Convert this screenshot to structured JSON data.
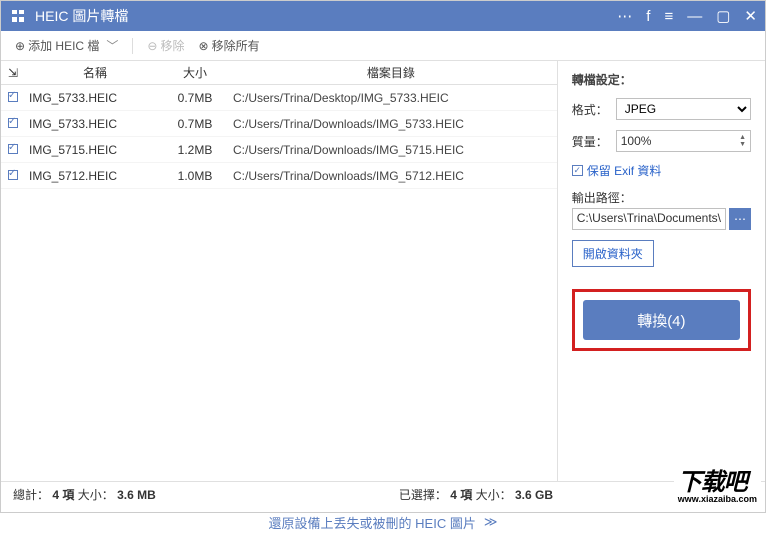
{
  "app": {
    "title": "HEIC 圖片轉檔"
  },
  "toolbar": {
    "add_label": "添加 HEIC 檔",
    "remove_label": "移除",
    "remove_all_label": "移除所有"
  },
  "columns": {
    "name": "名稱",
    "size": "大小",
    "path": "檔案目錄"
  },
  "files": [
    {
      "name": "IMG_5733.HEIC",
      "size": "0.7MB",
      "path": "C:/Users/Trina/Desktop/IMG_5733.HEIC"
    },
    {
      "name": "IMG_5733.HEIC",
      "size": "0.7MB",
      "path": "C:/Users/Trina/Downloads/IMG_5733.HEIC"
    },
    {
      "name": "IMG_5715.HEIC",
      "size": "1.2MB",
      "path": "C:/Users/Trina/Downloads/IMG_5715.HEIC"
    },
    {
      "name": "IMG_5712.HEIC",
      "size": "1.0MB",
      "path": "C:/Users/Trina/Downloads/IMG_5712.HEIC"
    }
  ],
  "settings": {
    "title": "轉檔設定：",
    "format_label": "格式：",
    "format_value": "JPEG",
    "quality_label": "質量：",
    "quality_value": "100%",
    "keep_exif": "保留 Exif 資料",
    "output_label": "輸出路徑：",
    "output_path": "C:\\Users\\Trina\\Documents\\",
    "open_folder": "開啟資料夾"
  },
  "convert": {
    "label": "轉換(4)"
  },
  "status": {
    "total_label": "總計：",
    "total_count": "4 項",
    "total_size_label": "大小：",
    "total_size": "3.6 MB",
    "selected_label": "已選擇：",
    "selected_count": "4 項",
    "selected_size_label": "大小：",
    "selected_size": "3.6 GB"
  },
  "footer": {
    "link": "還原設備上丢失或被刪的 HEIC 圖片"
  },
  "watermark": {
    "text": "下载吧",
    "url": "www.xiazaiba.com"
  }
}
